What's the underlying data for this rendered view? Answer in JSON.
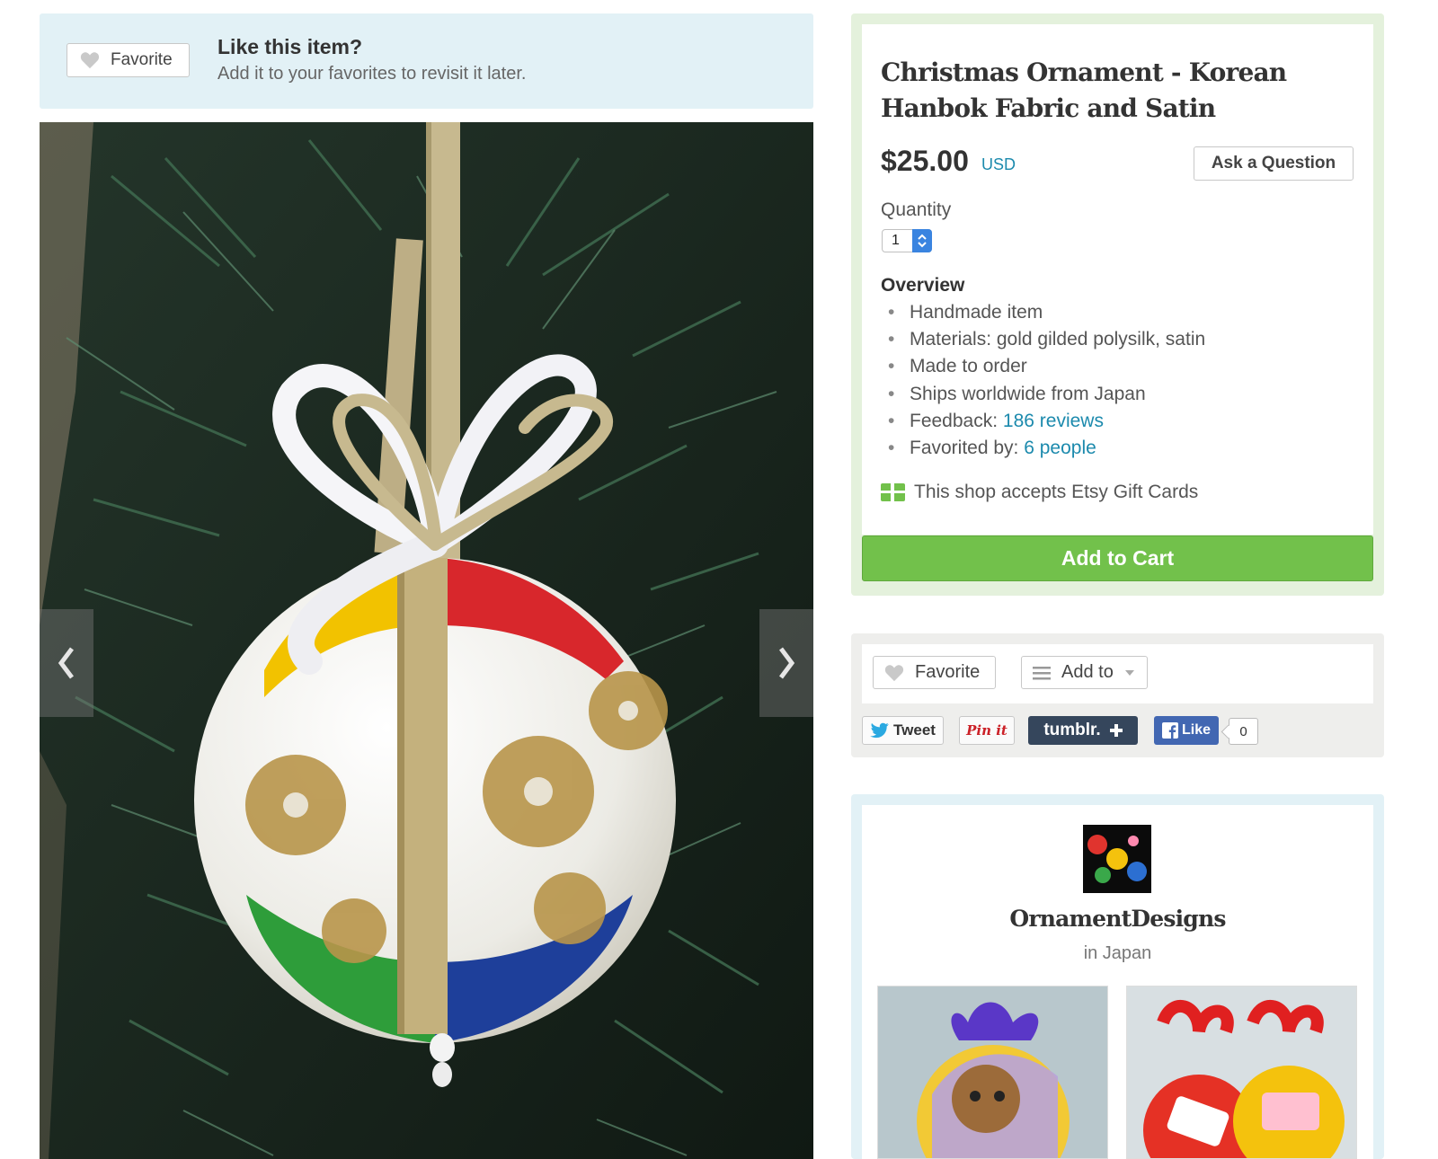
{
  "favorite_banner": {
    "button_label": "Favorite",
    "heading": "Like this item?",
    "subtext": "Add it to your favorites to revisit it later."
  },
  "listing": {
    "title": "Christmas Ornament - Korean Hanbok Fabric and Satin",
    "price": "$25.00",
    "currency": "USD",
    "ask_button": "Ask a Question",
    "quantity_label": "Quantity",
    "quantity_value": "1",
    "overview_heading": "Overview",
    "overview": {
      "handmade": "Handmade item",
      "materials": "Materials: gold gilded polysilk, satin",
      "made_to_order": "Made to order",
      "ships": "Ships worldwide from Japan",
      "feedback_label": "Feedback:",
      "feedback_link": "186 reviews",
      "favorited_label": "Favorited by:",
      "favorited_link": "6 people"
    },
    "gift_cards": "This shop accepts Etsy Gift Cards",
    "add_to_cart": "Add to Cart"
  },
  "actions": {
    "favorite": "Favorite",
    "add_to": "Add to",
    "tweet": "Tweet",
    "pinit": "Pin it",
    "tumblr": "tumblr.",
    "like": "Like",
    "like_count": "0"
  },
  "shop": {
    "name": "OrnamentDesigns",
    "location": "in Japan"
  },
  "colors": {
    "link": "#1c8aad",
    "cart_green": "#72c14b",
    "banner_blue": "#e2f1f6",
    "buy_box_green": "#e4f1dc"
  },
  "icons": [
    "heart-icon",
    "chevron-left-icon",
    "chevron-right-icon",
    "gift-card-icon",
    "list-icon",
    "caret-down-icon",
    "twitter-bird-icon",
    "facebook-icon",
    "plus-icon"
  ]
}
